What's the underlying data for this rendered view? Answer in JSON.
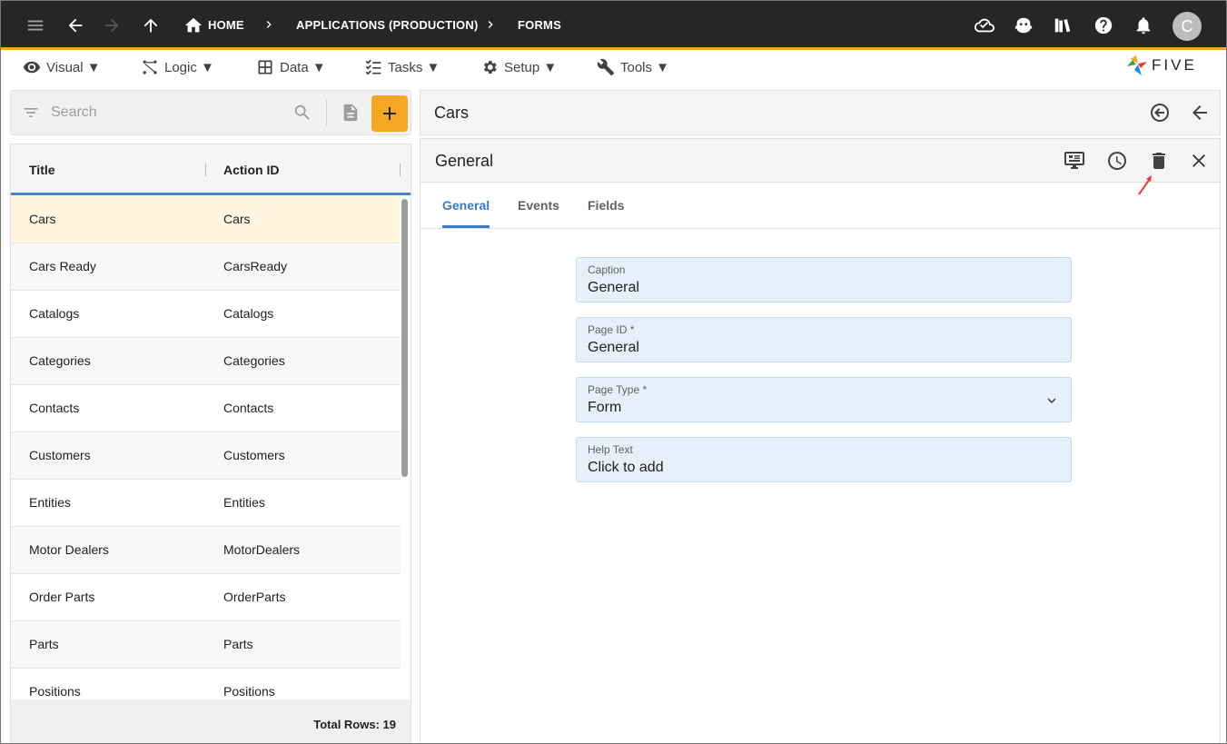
{
  "topbar": {
    "breadcrumbs": [
      "HOME",
      "APPLICATIONS (PRODUCTION)",
      "FORMS"
    ],
    "avatar_letter": "C"
  },
  "menu": {
    "items": [
      "Visual ▼",
      "Logic ▼",
      "Data ▼",
      "Tasks ▼",
      "Setup ▼",
      "Tools ▼"
    ]
  },
  "logo_text": "FIVE",
  "search": {
    "placeholder": "Search"
  },
  "list": {
    "columns": [
      "Title",
      "Action ID"
    ],
    "rows": [
      {
        "title": "Cars",
        "action_id": "Cars"
      },
      {
        "title": "Cars Ready",
        "action_id": "CarsReady"
      },
      {
        "title": "Catalogs",
        "action_id": "Catalogs"
      },
      {
        "title": "Categories",
        "action_id": "Categories"
      },
      {
        "title": "Contacts",
        "action_id": "Contacts"
      },
      {
        "title": "Customers",
        "action_id": "Customers"
      },
      {
        "title": "Entities",
        "action_id": "Entities"
      },
      {
        "title": "Motor Dealers",
        "action_id": "MotorDealers"
      },
      {
        "title": "Order Parts",
        "action_id": "OrderParts"
      },
      {
        "title": "Parts",
        "action_id": "Parts"
      },
      {
        "title": "Positions",
        "action_id": "Positions"
      }
    ],
    "total_rows": "Total Rows: 19"
  },
  "detail": {
    "title": "Cars",
    "form_title": "General",
    "tabs": [
      "General",
      "Events",
      "Fields"
    ],
    "fields": [
      {
        "label": "Caption",
        "value": "General"
      },
      {
        "label": "Page ID *",
        "value": "General"
      },
      {
        "label": "Page Type *",
        "value": "Form"
      },
      {
        "label": "Help Text",
        "value": "Click to add"
      }
    ]
  },
  "colors": {
    "topbar_bg": "#262626",
    "accent": "#f5a623",
    "primary": "#3a7bc8",
    "selected_row": "#fff5e1",
    "field_bg": "#e6f0fb"
  }
}
